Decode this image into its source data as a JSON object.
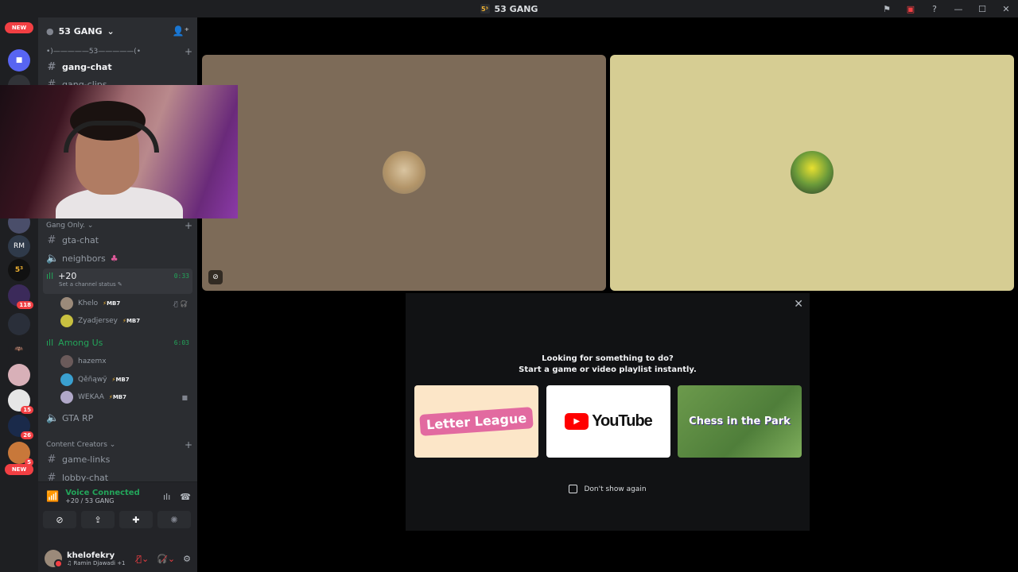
{
  "window": {
    "title": "53 GANG",
    "server_icon_text": "5³",
    "controls": [
      "⚑",
      "▣",
      "?",
      "—",
      "☐",
      "✕"
    ]
  },
  "guild_bar": {
    "new_top": "NEW",
    "new_bottom": "NEW",
    "badges": [
      "118",
      "15",
      "26",
      "5"
    ],
    "rm_label": "RM",
    "five_three_label": "5³"
  },
  "sidebar": {
    "server_name": "53 GANG",
    "top_separator": "•)—————53—————(•",
    "channels_top": [
      {
        "name": "gang-chat",
        "active": true
      },
      {
        "name": "gang-clips",
        "active": false
      }
    ],
    "category_gang": "Gang Only.",
    "channels_gang": [
      {
        "name": "gta-chat",
        "type": "text"
      },
      {
        "name": "neighbors",
        "type": "voice"
      }
    ],
    "voice_20": {
      "name": "+20",
      "timer": "0:33",
      "status": "Set a channel status"
    },
    "voice_20_members": [
      {
        "name": "Khelo",
        "tag": "MB7"
      },
      {
        "name": "Zyadjersey",
        "tag": "MB7"
      }
    ],
    "voice_among": {
      "name": "Among Us",
      "timer": "6:03"
    },
    "voice_among_members": [
      {
        "name": "hazemx",
        "tag": ""
      },
      {
        "name": "Qěñąwÿ",
        "tag": "MB7"
      },
      {
        "name": "WEKAA",
        "tag": "MB7"
      }
    ],
    "voice_gta": {
      "name": "GTA RP"
    },
    "category_creators": "Content Creators",
    "channels_creators": [
      {
        "name": "game-links"
      },
      {
        "name": "lobby-chat"
      }
    ]
  },
  "voice_panel": {
    "title": "Voice Connected",
    "subtitle": "+20 / 53 GANG"
  },
  "user_panel": {
    "username": "khelofekry",
    "activity": "Ramin Djawadi +1"
  },
  "activity_modal": {
    "line1": "Looking for something to do?",
    "line2": "Start a game or video playlist instantly.",
    "cards": [
      {
        "name": "Letter League"
      },
      {
        "name": "YouTube"
      },
      {
        "name": "Chess in the Park"
      }
    ],
    "dont_show": "Don't show again"
  },
  "colors": {
    "tile_left": "#7d6b58",
    "tile_right": "#d6cd93",
    "voice_green": "#23a55a",
    "badge_red": "#f23f43"
  }
}
